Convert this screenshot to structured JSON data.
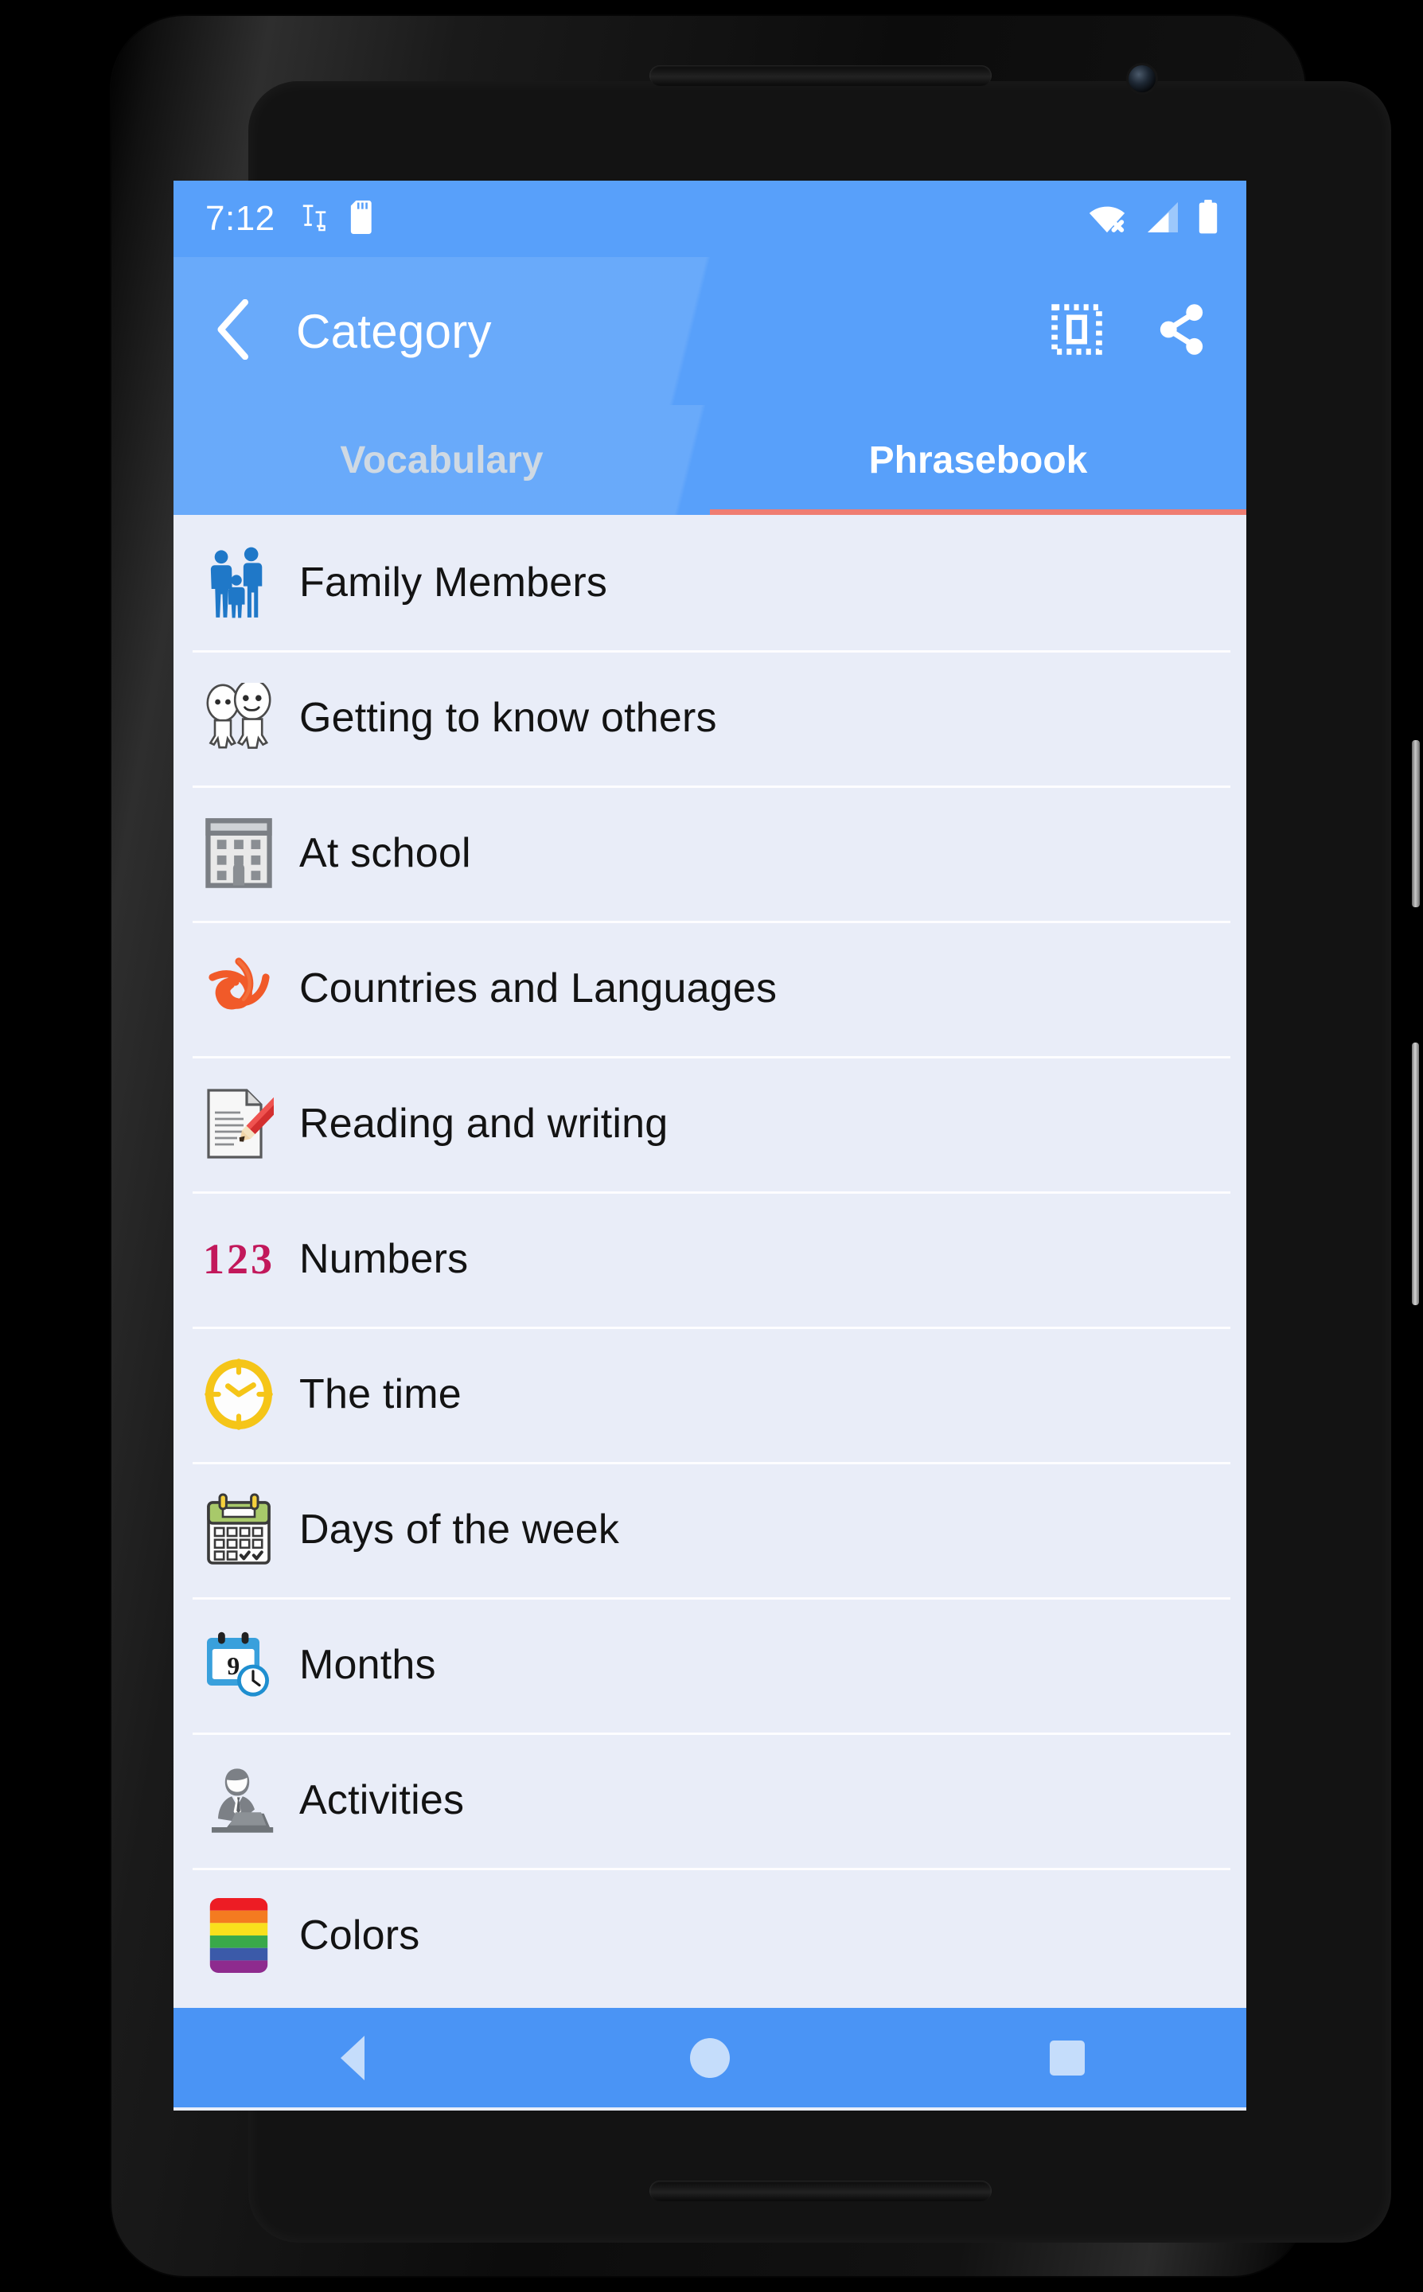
{
  "status_bar": {
    "clock": "7:12",
    "left_icons": [
      "screenshot-icon",
      "sd-card-icon"
    ],
    "right_icons": [
      "wifi-off-icon",
      "cellular-signal-icon",
      "battery-full-icon"
    ],
    "background_color": "#58a0fa",
    "text_color": "#ffffff"
  },
  "toolbar": {
    "back_icon": "chevron-left-icon",
    "title": "Category",
    "actions": [
      {
        "name": "select-all-icon",
        "label": "Select all"
      },
      {
        "name": "share-icon",
        "label": "Share"
      }
    ],
    "background_color": "#58a0fa"
  },
  "tabs": {
    "items": [
      {
        "label": "Vocabulary",
        "active": false
      },
      {
        "label": "Phrasebook",
        "active": true
      }
    ],
    "indicator_color": "#ef7d72",
    "active_color": "#ffffff",
    "inactive_color": "#cfd9e3"
  },
  "category_list": {
    "background_color": "#e9edf8",
    "divider_color": "#fdfdff",
    "items": [
      {
        "label": "Family Members",
        "icon": "family-icon"
      },
      {
        "label": "Getting to know others",
        "icon": "two-people-talking-icon"
      },
      {
        "label": "At school",
        "icon": "school-building-icon"
      },
      {
        "label": "Countries and Languages",
        "icon": "triskelion-knot-icon"
      },
      {
        "label": "Reading and writing",
        "icon": "document-pencil-icon"
      },
      {
        "label": "Numbers",
        "icon": "numbers-123-icon",
        "glyph": "123"
      },
      {
        "label": "The time",
        "icon": "clock-icon"
      },
      {
        "label": "Days of the week",
        "icon": "calendar-check-icon"
      },
      {
        "label": "Months",
        "icon": "calendar-clock-icon",
        "glyph": "9"
      },
      {
        "label": "Activities",
        "icon": "person-at-laptop-icon"
      },
      {
        "label": "Colors",
        "icon": "rainbow-swatch-icon"
      }
    ]
  },
  "nav_bar": {
    "background_color": "#4a94f5",
    "icon_color": "#c5ddfb",
    "buttons": [
      {
        "name": "nav-back-button",
        "label": "Back"
      },
      {
        "name": "nav-home-button",
        "label": "Home"
      },
      {
        "name": "nav-recents-button",
        "label": "Recents"
      }
    ]
  }
}
